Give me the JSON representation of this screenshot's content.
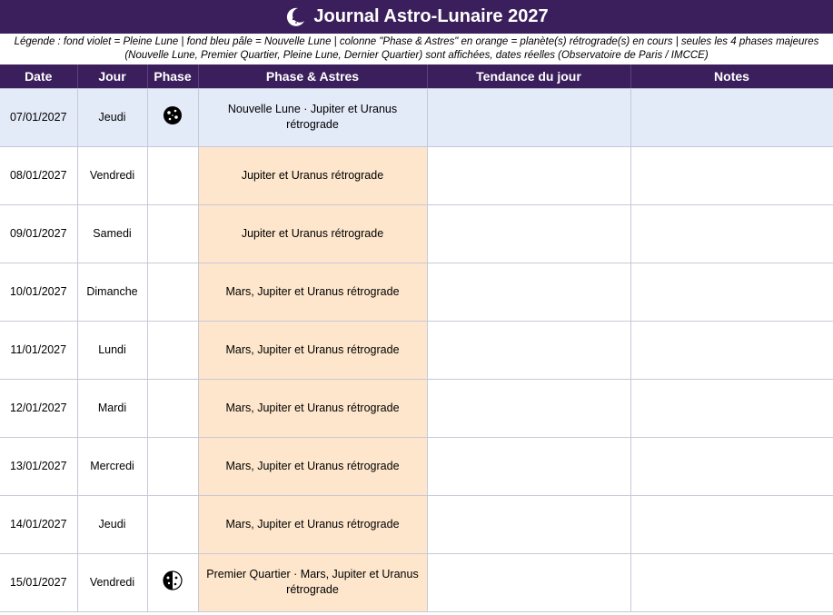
{
  "title": "Journal Astro-Lunaire 2027",
  "legend": "Légende : fond violet = Pleine Lune  |  fond bleu pâle = Nouvelle Lune  |  colonne \"Phase & Astres\" en orange = planète(s) rétrograde(s) en cours  |  seules les 4 phases majeures (Nouvelle Lune, Premier Quartier, Pleine Lune, Dernier Quartier) sont affichées, dates réelles (Observatoire de Paris / IMCCE)",
  "colors": {
    "header_bg": "#3b1f5c",
    "new_moon_row": "#e3eaf8",
    "retrograde_cell": "#fde6cc"
  },
  "columns": {
    "date": "Date",
    "jour": "Jour",
    "phase": "Phase",
    "astres": "Phase & Astres",
    "tendance": "Tendance du jour",
    "notes": "Notes"
  },
  "rows": [
    {
      "date": "07/01/2027",
      "jour": "Jeudi",
      "phase_icon": "new-moon-icon",
      "astres": "Nouvelle Lune · Jupiter et Uranus rétrograde",
      "tendance": "",
      "notes": "",
      "row_type": "new-moon"
    },
    {
      "date": "08/01/2027",
      "jour": "Vendredi",
      "phase_icon": "",
      "astres": "Jupiter et Uranus rétrograde",
      "tendance": "",
      "notes": "",
      "row_type": "retrograde"
    },
    {
      "date": "09/01/2027",
      "jour": "Samedi",
      "phase_icon": "",
      "astres": "Jupiter et Uranus rétrograde",
      "tendance": "",
      "notes": "",
      "row_type": "retrograde"
    },
    {
      "date": "10/01/2027",
      "jour": "Dimanche",
      "phase_icon": "",
      "astres": "Mars, Jupiter et Uranus rétrograde",
      "tendance": "",
      "notes": "",
      "row_type": "retrograde"
    },
    {
      "date": "11/01/2027",
      "jour": "Lundi",
      "phase_icon": "",
      "astres": "Mars, Jupiter et Uranus rétrograde",
      "tendance": "",
      "notes": "",
      "row_type": "retrograde"
    },
    {
      "date": "12/01/2027",
      "jour": "Mardi",
      "phase_icon": "",
      "astres": "Mars, Jupiter et Uranus rétrograde",
      "tendance": "",
      "notes": "",
      "row_type": "retrograde"
    },
    {
      "date": "13/01/2027",
      "jour": "Mercredi",
      "phase_icon": "",
      "astres": "Mars, Jupiter et Uranus rétrograde",
      "tendance": "",
      "notes": "",
      "row_type": "retrograde"
    },
    {
      "date": "14/01/2027",
      "jour": "Jeudi",
      "phase_icon": "",
      "astres": "Mars, Jupiter et Uranus rétrograde",
      "tendance": "",
      "notes": "",
      "row_type": "retrograde"
    },
    {
      "date": "15/01/2027",
      "jour": "Vendredi",
      "phase_icon": "first-quarter-icon",
      "astres": "Premier Quartier · Mars, Jupiter et Uranus rétrograde",
      "tendance": "",
      "notes": "",
      "row_type": "retrograde"
    }
  ]
}
